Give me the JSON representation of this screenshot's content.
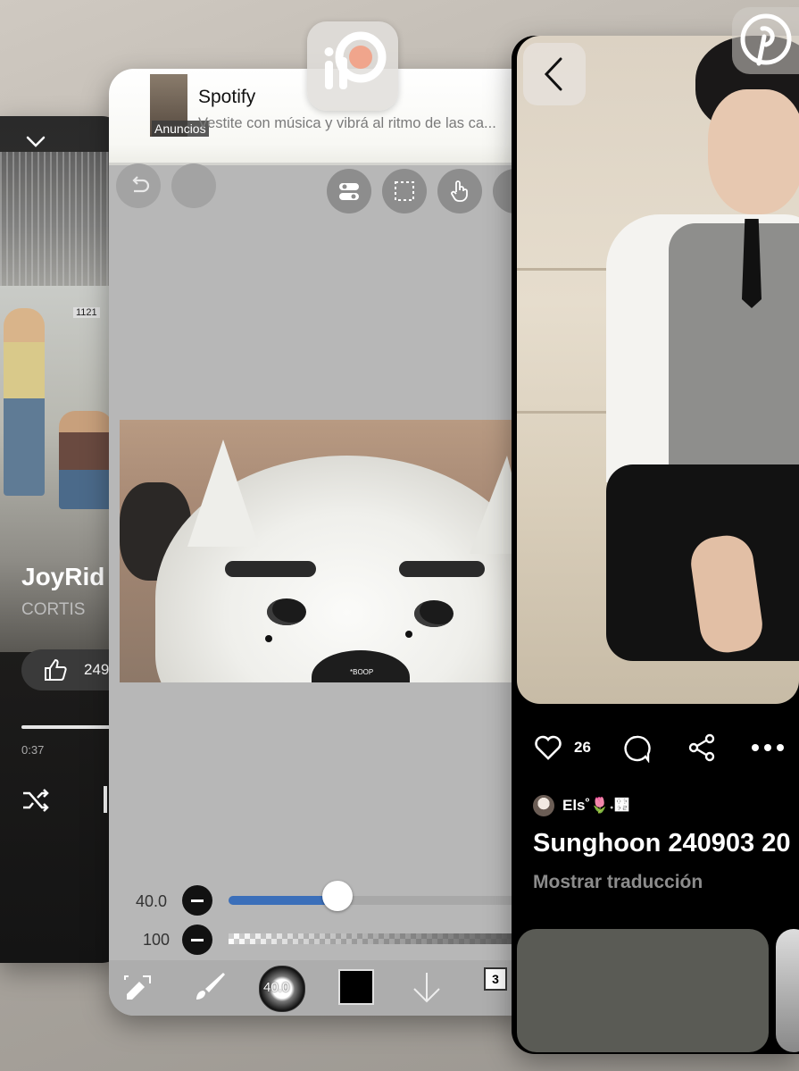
{
  "music_app": {
    "song_title": "JoyRid",
    "artist": "CORTIS",
    "photo_sign": "1121",
    "like_count": "249",
    "elapsed_time": "0:37",
    "progress_fraction": 0.9
  },
  "drawing_app": {
    "ad": {
      "title": "Spotify",
      "subtitle": "Vestite con música y vibrá al ritmo de las ca...",
      "badge": "Anuncios"
    },
    "image_caption": "*BOOP",
    "brush_size_label": "40.0",
    "opacity_label": "100",
    "brush_size_value": 40.0,
    "slider_fraction": 0.36,
    "brush_preview_label": "40.0",
    "current_color": "#000000",
    "layer_count": "3",
    "accent_color": "#3b6fba"
  },
  "pinterest_app": {
    "like_count": "26",
    "username": "Els˚🌷˖঒",
    "pin_title": "Sunghoon 240903 20",
    "translate_link": "Mostrar traducción"
  }
}
